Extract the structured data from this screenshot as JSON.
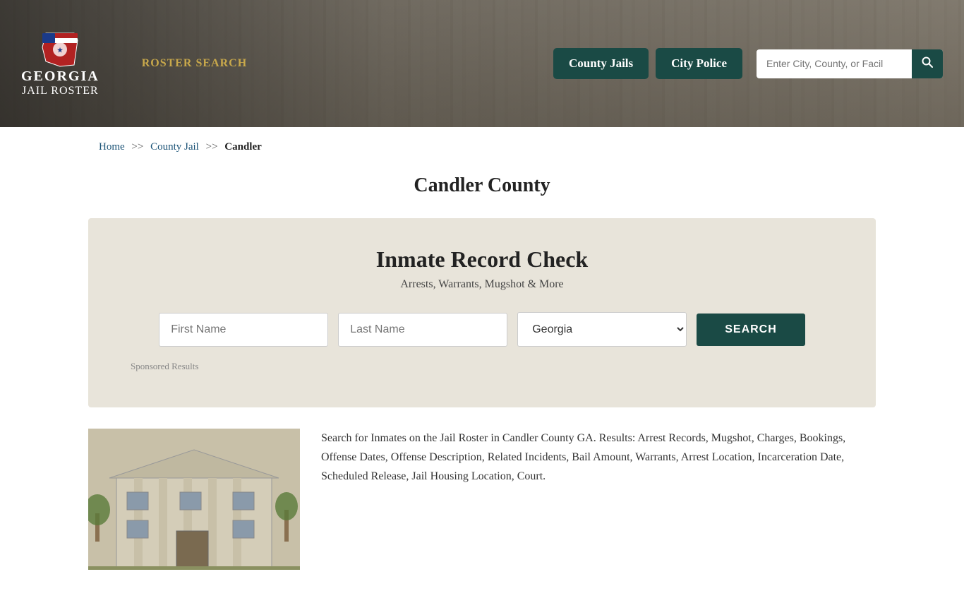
{
  "header": {
    "logo_georgia": "GEORGIA",
    "logo_jail_roster": "JAIL ROSTER",
    "roster_search_label": "ROSTER SEARCH",
    "nav": {
      "county_jails": "County Jails",
      "city_police": "City Police"
    },
    "search_placeholder": "Enter City, County, or Facil"
  },
  "breadcrumb": {
    "home": "Home",
    "sep1": ">>",
    "county_jail": "County Jail",
    "sep2": ">>",
    "current": "Candler"
  },
  "page_title": "Candler County",
  "record_check": {
    "title": "Inmate Record Check",
    "subtitle": "Arrests, Warrants, Mugshot & More",
    "first_name_placeholder": "First Name",
    "last_name_placeholder": "Last Name",
    "state_default": "Georgia",
    "search_btn": "SEARCH",
    "sponsored": "Sponsored Results"
  },
  "bottom": {
    "description": "Search for Inmates on the Jail Roster in Candler County GA. Results: Arrest Records, Mugshot, Charges, Bookings, Offense Dates, Offense Description, Related Incidents, Bail Amount, Warrants, Arrest Location, Incarceration Date, Scheduled Release, Jail Housing Location, Court."
  },
  "colors": {
    "nav_btn_bg": "#1a4a45",
    "search_btn_bg": "#1a4a45",
    "link_color": "#1a5276",
    "record_bg": "#e8e4da"
  }
}
